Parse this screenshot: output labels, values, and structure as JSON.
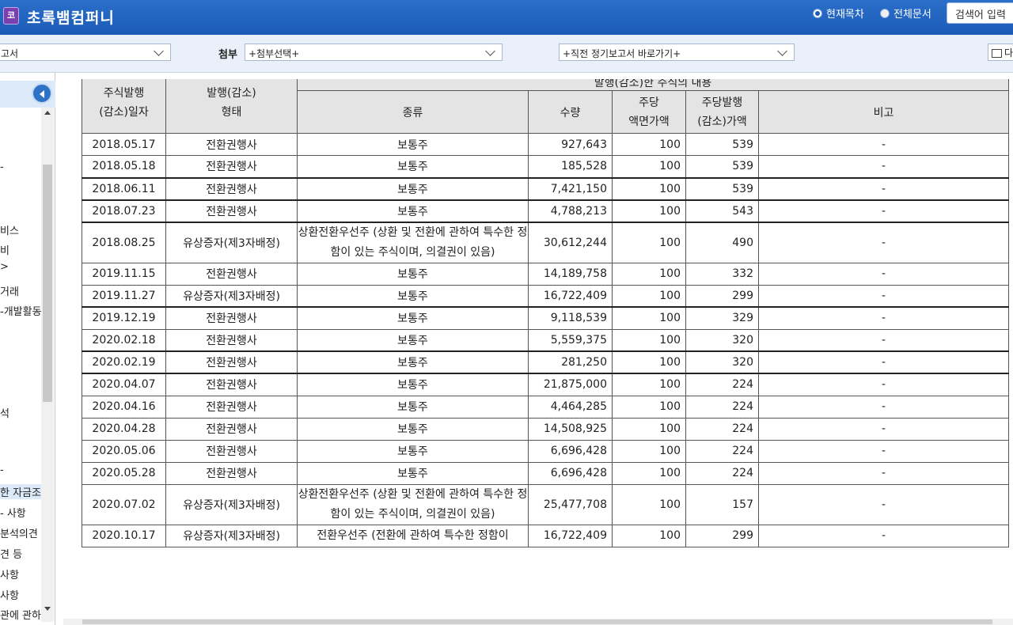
{
  "header": {
    "logo_char": "코",
    "company_name": "초록뱀컴퍼니",
    "radio_current_toc": "현재목차",
    "radio_whole_doc": "전체문서",
    "search_placeholder": "검색어 입력"
  },
  "toolbar": {
    "doc_select_value": "고서",
    "attach_label": "첨부",
    "attach_select_value": "+첨부선택+",
    "prev_report_select_value": "+직전 정기보고서 바로가기+",
    "print_label": "다"
  },
  "sidebar": {
    "items": [
      "-",
      "비스",
      "비",
      ">",
      "거래",
      "-개발활동",
      "석",
      "-",
      "한 자금조",
      "- 사항",
      "분석의견",
      "견 등",
      "사항",
      "사항",
      "관에 관하"
    ]
  },
  "table": {
    "header_group_label": "발행(감소)한 주식의 내용",
    "columns": {
      "date": "주식발행\n(감소)일자",
      "type": "발행(감소)\n형태",
      "kind": "종류",
      "qty": "수량",
      "par": "주당\n액면가액",
      "price": "주당발행\n(감소)가액",
      "note": "비고"
    },
    "rows": [
      {
        "date": "2018.05.17",
        "type": "전환권행사",
        "kind": "보통주",
        "qty": "927,643",
        "par": "100",
        "price": "539",
        "note": "-"
      },
      {
        "date": "2018.05.18",
        "type": "전환권행사",
        "kind": "보통주",
        "qty": "185,528",
        "par": "100",
        "price": "539",
        "note": "-"
      },
      {
        "date": "2018.06.11",
        "type": "전환권행사",
        "kind": "보통주",
        "qty": "7,421,150",
        "par": "100",
        "price": "539",
        "note": "-"
      },
      {
        "date": "2018.07.23",
        "type": "전환권행사",
        "kind": "보통주",
        "qty": "4,788,213",
        "par": "100",
        "price": "543",
        "note": "-"
      },
      {
        "date": "2018.08.25",
        "type": "유상증자(제3자배정)",
        "kind": "상환전환우선주\n(상환 및 전환에 관하여 특수한 정함이\n있는 주식이며, 의결권이 있음)",
        "qty": "30,612,244",
        "par": "100",
        "price": "490",
        "note": "-"
      },
      {
        "date": "2019.11.15",
        "type": "전환권행사",
        "kind": "보통주",
        "qty": "14,189,758",
        "par": "100",
        "price": "332",
        "note": "-"
      },
      {
        "date": "2019.11.27",
        "type": "유상증자(제3자배정)",
        "kind": "보통주",
        "qty": "16,722,409",
        "par": "100",
        "price": "299",
        "note": "-"
      },
      {
        "date": "2019.12.19",
        "type": "전환권행사",
        "kind": "보통주",
        "qty": "9,118,539",
        "par": "100",
        "price": "329",
        "note": "-"
      },
      {
        "date": "2020.02.18",
        "type": "전환권행사",
        "kind": "보통주",
        "qty": "5,559,375",
        "par": "100",
        "price": "320",
        "note": "-"
      },
      {
        "date": "2020.02.19",
        "type": "전환권행사",
        "kind": "보통주",
        "qty": "281,250",
        "par": "100",
        "price": "320",
        "note": "-"
      },
      {
        "date": "2020.04.07",
        "type": "전환권행사",
        "kind": "보통주",
        "qty": "21,875,000",
        "par": "100",
        "price": "224",
        "note": "-"
      },
      {
        "date": "2020.04.16",
        "type": "전환권행사",
        "kind": "보통주",
        "qty": "4,464,285",
        "par": "100",
        "price": "224",
        "note": "-"
      },
      {
        "date": "2020.04.28",
        "type": "전환권행사",
        "kind": "보통주",
        "qty": "14,508,925",
        "par": "100",
        "price": "224",
        "note": "-"
      },
      {
        "date": "2020.05.06",
        "type": "전환권행사",
        "kind": "보통주",
        "qty": "6,696,428",
        "par": "100",
        "price": "224",
        "note": "-"
      },
      {
        "date": "2020.05.28",
        "type": "전환권행사",
        "kind": "보통주",
        "qty": "6,696,428",
        "par": "100",
        "price": "224",
        "note": "-"
      },
      {
        "date": "2020.07.02",
        "type": "유상증자(제3자배정)",
        "kind": "상환전환우선주\n(상환 및 전환에 관하여 특수한 정함이\n있는 주식이며, 의결권이 있음)",
        "qty": "25,477,708",
        "par": "100",
        "price": "157",
        "note": "-"
      },
      {
        "date": "2020.10.17",
        "type": "유상증자(제3자배정)",
        "kind": "전환우선주\n(전환에 관하여 특수한 정함이",
        "qty": "16,722,409",
        "par": "100",
        "price": "299",
        "note": "-"
      }
    ]
  }
}
